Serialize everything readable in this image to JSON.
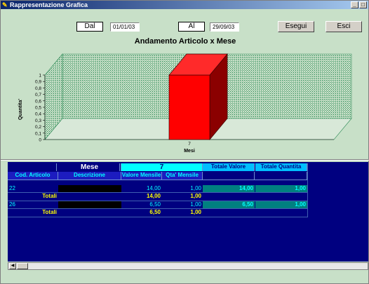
{
  "window": {
    "title": "Rappresentazione Grafica"
  },
  "toolbar": {
    "dal_label": "Dal",
    "dal_value": "01/01/03",
    "al_label": "Al",
    "al_value": "29/09/03",
    "esegui_label": "Esegui",
    "esci_label": "Esci"
  },
  "chart_data": {
    "type": "bar",
    "title": "Andamento Articolo x Mese",
    "xlabel": "Mesi",
    "ylabel": "Quantita'",
    "categories": [
      "7"
    ],
    "values": [
      1.0
    ],
    "ylim": [
      0,
      1
    ],
    "yticks": [
      "0",
      "0,1",
      "0,2",
      "0,3",
      "0,4",
      "0,5",
      "0,6",
      "0,7",
      "0,8",
      "0,9",
      "1"
    ],
    "bar_color": "#ff0000",
    "grid": true
  },
  "grid": {
    "mese_label": "Mese",
    "mese_value": "7",
    "totale_valore_label": "Totale Valore",
    "totale_quantita_label": "Totale Quantita",
    "col_cod_articolo": "Cod. Articolo",
    "col_descrizione": "Descrizione",
    "col_valore_mensile": "Valore Mensile",
    "col_qta_mensile": "Qta' Mensile",
    "rows": [
      {
        "cod": "22",
        "descrizione": "",
        "valore": "14,00",
        "qta": "1,00",
        "tot_valore": "14,00",
        "tot_qta": "1,00"
      },
      {
        "totali_label": "Totali",
        "valore": "14,00",
        "qta": "1,00"
      },
      {
        "cod": "26",
        "descrizione": "",
        "valore": "6,50",
        "qta": "1,00",
        "tot_valore": "6,50",
        "tot_qta": "1,00"
      },
      {
        "totali_label": "Totali",
        "valore": "6,50",
        "qta": "1,00"
      }
    ]
  }
}
